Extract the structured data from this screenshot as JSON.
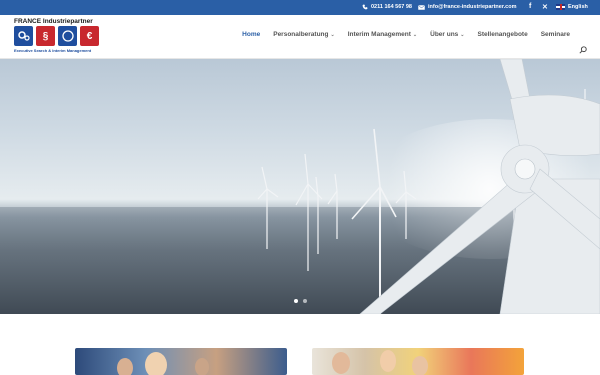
{
  "topbar": {
    "phone": "0211 164 567 98",
    "email": "info@france-industriepartner.com",
    "language": "English",
    "icons": [
      "phone-icon",
      "mail-icon",
      "facebook-icon",
      "xing-icon",
      "uk-flag-icon"
    ]
  },
  "logo": {
    "title": "FRANCE Industriepartner",
    "subtitle": "Executive Search & Interim Management",
    "tiles": [
      "gears-icon",
      "section-sign-icon",
      "compass-icon",
      "euro-icon"
    ]
  },
  "nav": {
    "items": [
      {
        "label": "Home",
        "active": true,
        "dropdown": false
      },
      {
        "label": "Personalberatung",
        "active": false,
        "dropdown": true
      },
      {
        "label": "Interim Management",
        "active": false,
        "dropdown": true
      },
      {
        "label": "Über uns",
        "active": false,
        "dropdown": true
      },
      {
        "label": "Stellenangebote",
        "active": false,
        "dropdown": false
      },
      {
        "label": "Seminare",
        "active": false,
        "dropdown": false
      }
    ]
  },
  "hero": {
    "image": "offshore wind turbines over sea",
    "slides": 2,
    "active_slide": 1
  },
  "colors": {
    "topbar": "#2a5fa6",
    "nav_active": "#2a5fa6",
    "nav_text": "#555555",
    "logo_blue": "#1f4e9e",
    "logo_red": "#c8282e"
  }
}
